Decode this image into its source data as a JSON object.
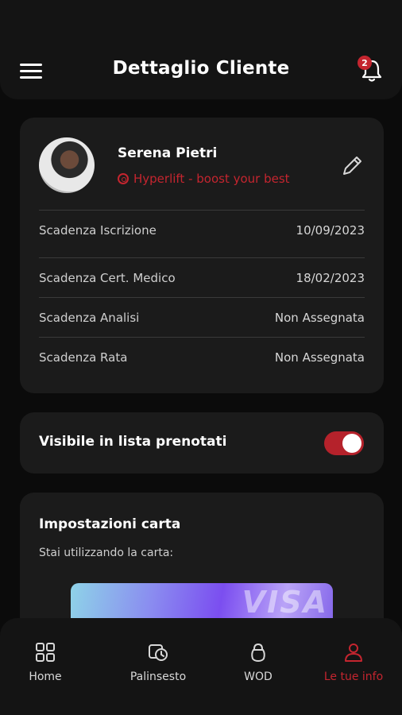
{
  "header": {
    "title": "Dettaglio Cliente",
    "notifications_count": "2"
  },
  "profile": {
    "name": "Serena Pietri",
    "gym": "Hyperlift - boost your best",
    "rows": [
      {
        "label": "Scadenza Iscrizione",
        "value": "10/09/2023"
      },
      {
        "label": "Scadenza Cert. Medico",
        "value": "18/02/2023"
      },
      {
        "label": "Scadenza Analisi",
        "value": "Non Assegnata"
      },
      {
        "label": "Scadenza Rata",
        "value": "Non Assegnata"
      }
    ]
  },
  "visibility": {
    "label": "Visibile in lista prenotati",
    "enabled": true
  },
  "card_settings": {
    "title": "Impostazioni carta",
    "subtitle": "Stai utilizzando la carta:",
    "brand": "VISA"
  },
  "nav": {
    "items": [
      {
        "label": "Home",
        "icon": "grid-icon"
      },
      {
        "label": "Palinsesto",
        "icon": "calendar-clock-icon"
      },
      {
        "label": "WOD",
        "icon": "kettlebell-icon"
      },
      {
        "label": "Le tue info",
        "icon": "user-icon",
        "active": true
      }
    ]
  },
  "colors": {
    "accent": "#c4252f",
    "background": "#0b0b0b",
    "card": "#1b1b1b"
  }
}
